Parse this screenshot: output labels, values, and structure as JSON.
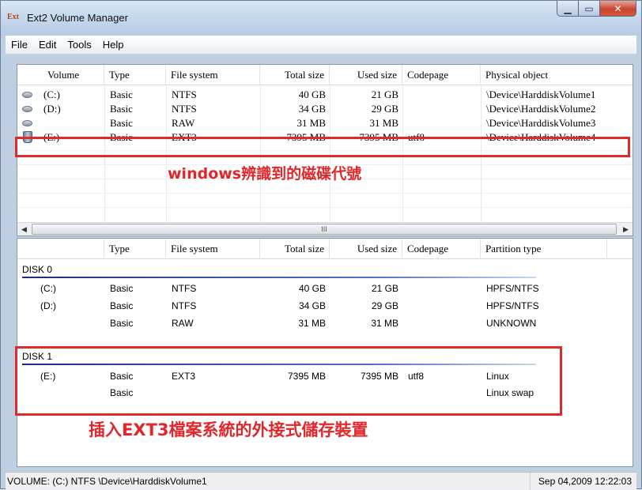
{
  "window": {
    "title": "Ext2 Volume Manager",
    "icon_text": "Ext"
  },
  "menu": [
    "File",
    "Edit",
    "Tools",
    "Help"
  ],
  "volumes": {
    "headers": [
      "Volume",
      "Type",
      "File system",
      "Total size",
      "Used size",
      "Codepage",
      "Physical object"
    ],
    "rows": [
      {
        "volume": "(C:)",
        "type": "Basic",
        "fs": "NTFS",
        "total": "40 GB",
        "used": "21 GB",
        "codepage": "",
        "object": "\\Device\\HarddiskVolume1",
        "icon": "hard-disk-icon"
      },
      {
        "volume": "(D:)",
        "type": "Basic",
        "fs": "NTFS",
        "total": "34 GB",
        "used": "29 GB",
        "codepage": "",
        "object": "\\Device\\HarddiskVolume2",
        "icon": "hard-disk-icon"
      },
      {
        "volume": "",
        "type": "Basic",
        "fs": "RAW",
        "total": "31 MB",
        "used": "31 MB",
        "codepage": "",
        "object": "\\Device\\HarddiskVolume3",
        "icon": "hard-disk-icon"
      },
      {
        "volume": "(E:)",
        "type": "Basic",
        "fs": "EXT3",
        "total": "7395 MB",
        "used": "7395 MB",
        "codepage": "utf8",
        "object": "\\Device\\HarddiskVolume4",
        "icon": "usb-drive-icon"
      }
    ]
  },
  "disks": {
    "headers": [
      "Type",
      "File system",
      "Total size",
      "Used size",
      "Codepage",
      "Partition type"
    ],
    "groups": [
      {
        "label": "DISK 0",
        "rows": [
          {
            "volume": "(C:)",
            "type": "Basic",
            "fs": "NTFS",
            "total": "40 GB",
            "used": "21 GB",
            "codepage": "",
            "ptype": "HPFS/NTFS"
          },
          {
            "volume": "(D:)",
            "type": "Basic",
            "fs": "NTFS",
            "total": "34 GB",
            "used": "29 GB",
            "codepage": "",
            "ptype": "HPFS/NTFS"
          },
          {
            "volume": "",
            "type": "Basic",
            "fs": "RAW",
            "total": "31 MB",
            "used": "31 MB",
            "codepage": "",
            "ptype": "UNKNOWN"
          }
        ]
      },
      {
        "label": "DISK 1",
        "rows": [
          {
            "volume": "(E:)",
            "type": "Basic",
            "fs": "EXT3",
            "total": "7395 MB",
            "used": "7395 MB",
            "codepage": "utf8",
            "ptype": "Linux"
          },
          {
            "volume": "",
            "type": "Basic",
            "fs": "",
            "total": "",
            "used": "",
            "codepage": "",
            "ptype": "Linux swap"
          }
        ]
      }
    ]
  },
  "annotations": {
    "top": "windows辨識到的磁碟代號",
    "bottom": "插入EXT3檔案系統的外接式儲存裝置"
  },
  "scrollbar": {
    "thumb_grip": "III",
    "left_arrow": "◀",
    "right_arrow": "▶"
  },
  "status": {
    "left": "VOLUME: (C:) NTFS \\Device\\HarddiskVolume1",
    "right": "Sep 04,2009 12:22:03"
  },
  "colors": {
    "annotation": "#e02a2a",
    "close_button": "#c7452e"
  }
}
